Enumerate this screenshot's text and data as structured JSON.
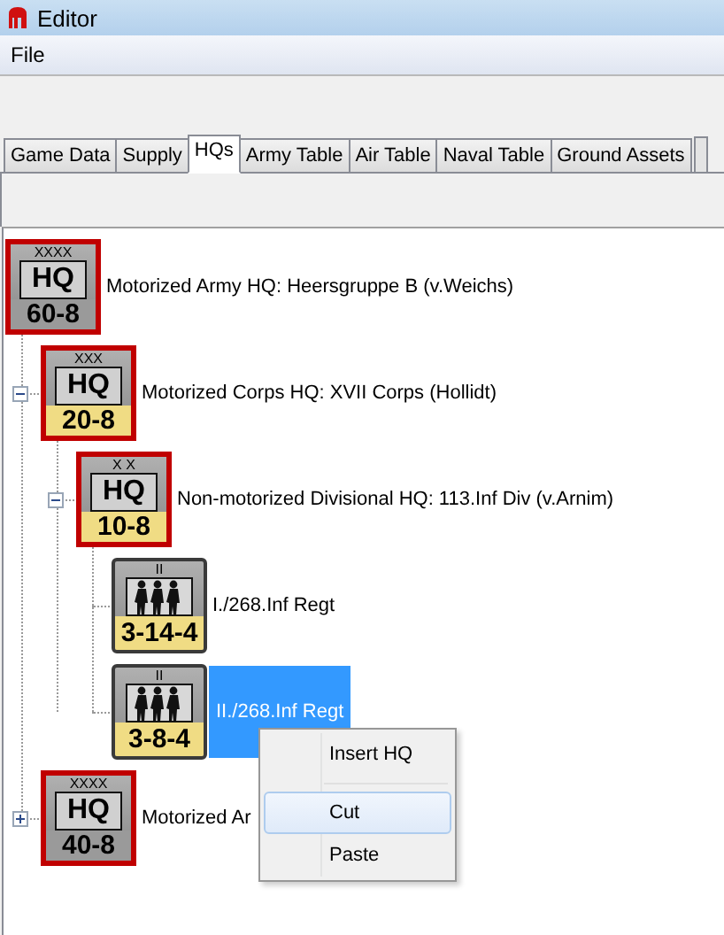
{
  "window": {
    "title": "Editor"
  },
  "menu": [
    "File"
  ],
  "tabs": [
    {
      "label": "Game Data",
      "selected": false
    },
    {
      "label": "Supply",
      "selected": false
    },
    {
      "label": "HQs",
      "selected": true
    },
    {
      "label": "Army Table",
      "selected": false
    },
    {
      "label": "Air Table",
      "selected": false
    },
    {
      "label": "Naval Table",
      "selected": false
    },
    {
      "label": "Ground Assets",
      "selected": false
    }
  ],
  "tree": [
    {
      "kind": "hq",
      "echelon": "XXXX",
      "symbol": "HQ",
      "strength": "60-8",
      "color": "#9a9a9a",
      "label": "Motorized Army HQ: Heersgruppe B (v.Weichs)",
      "selected": false,
      "children": [
        {
          "kind": "hq",
          "echelon": "XXX",
          "symbol": "HQ",
          "strength": "20-8",
          "color": "#f0dc84",
          "label": "Motorized Corps HQ: XVII Corps (Hollidt)",
          "selected": false,
          "expanded": true,
          "children": [
            {
              "kind": "hq",
              "echelon": "X X",
              "symbol": "HQ",
              "strength": "10-8",
              "color": "#f0dc84",
              "label": "Non-motorized Divisional HQ: 113.Inf Div (v.Arnim)",
              "selected": false,
              "expanded": true,
              "children": [
                {
                  "kind": "infantry",
                  "echelon": "II",
                  "strength": "3-14-4",
                  "color": "#f0dc84",
                  "label": "I./268.Inf Regt",
                  "selected": false
                },
                {
                  "kind": "infantry",
                  "echelon": "II",
                  "strength": "3-8-4",
                  "color": "#f0dc84",
                  "label": "II./268.Inf Regt",
                  "selected": true
                }
              ]
            }
          ]
        },
        {
          "kind": "hq",
          "echelon": "XXXX",
          "symbol": "HQ",
          "strength": "40-8",
          "color": "#9a9a9a",
          "label": "Motorized Ar",
          "selected": false,
          "expanded": false
        }
      ]
    }
  ],
  "context_menu": [
    {
      "label": "Insert HQ",
      "selected": false
    },
    {
      "label": "Cut",
      "selected": true
    },
    {
      "label": "Paste",
      "selected": false
    }
  ]
}
